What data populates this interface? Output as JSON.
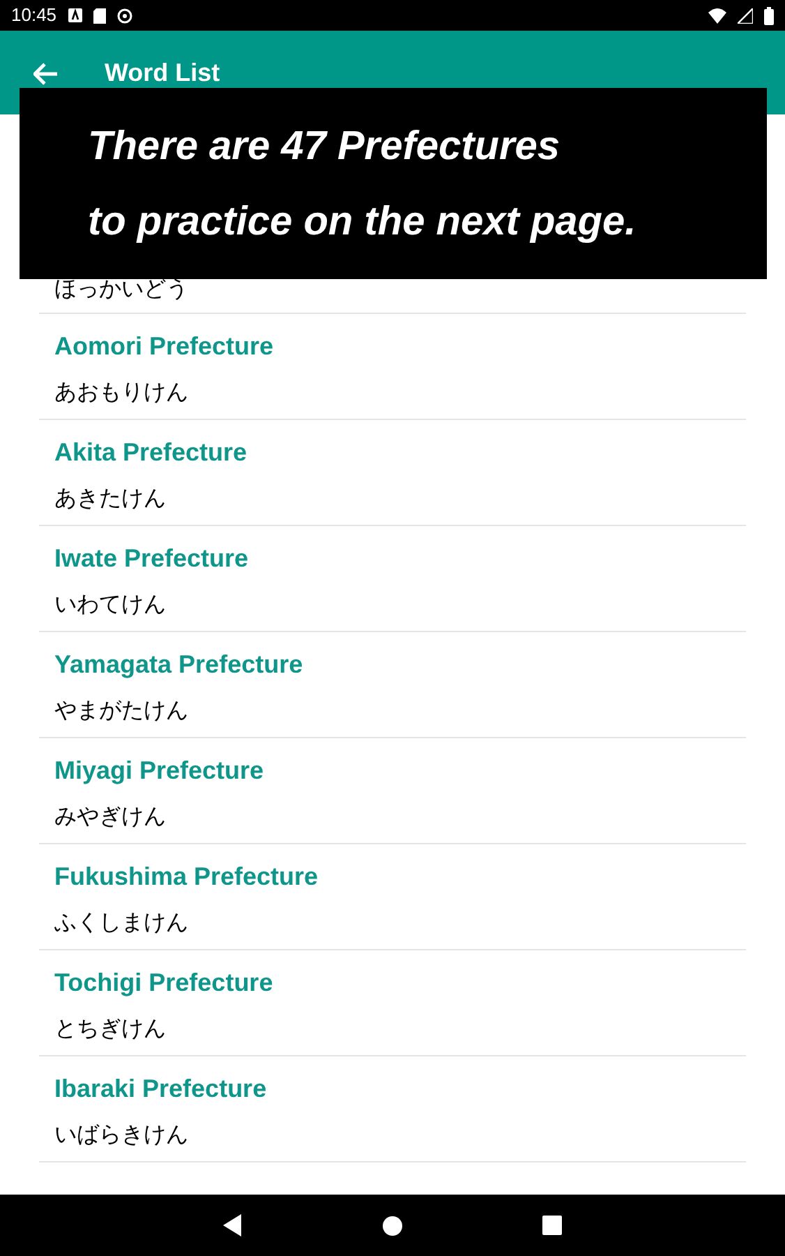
{
  "status_bar": {
    "time": "10:45"
  },
  "app_bar": {
    "title": "Word List"
  },
  "overlay": {
    "lines": [
      "There are 47 Prefectures",
      "to practice on the next page."
    ]
  },
  "words": [
    {
      "reading": "ほっかいどう"
    },
    {
      "title": "Aomori Prefecture",
      "reading": "あおもりけん"
    },
    {
      "title": "Akita Prefecture",
      "reading": "あきたけん"
    },
    {
      "title": "Iwate Prefecture",
      "reading": "いわてけん"
    },
    {
      "title": "Yamagata Prefecture",
      "reading": "やまがたけん"
    },
    {
      "title": "Miyagi Prefecture",
      "reading": "みやぎけん"
    },
    {
      "title": "Fukushima Prefecture",
      "reading": "ふくしまけん"
    },
    {
      "title": "Tochigi Prefecture",
      "reading": "とちぎけん"
    },
    {
      "title": "Ibaraki Prefecture",
      "reading": "いばらきけん"
    }
  ]
}
